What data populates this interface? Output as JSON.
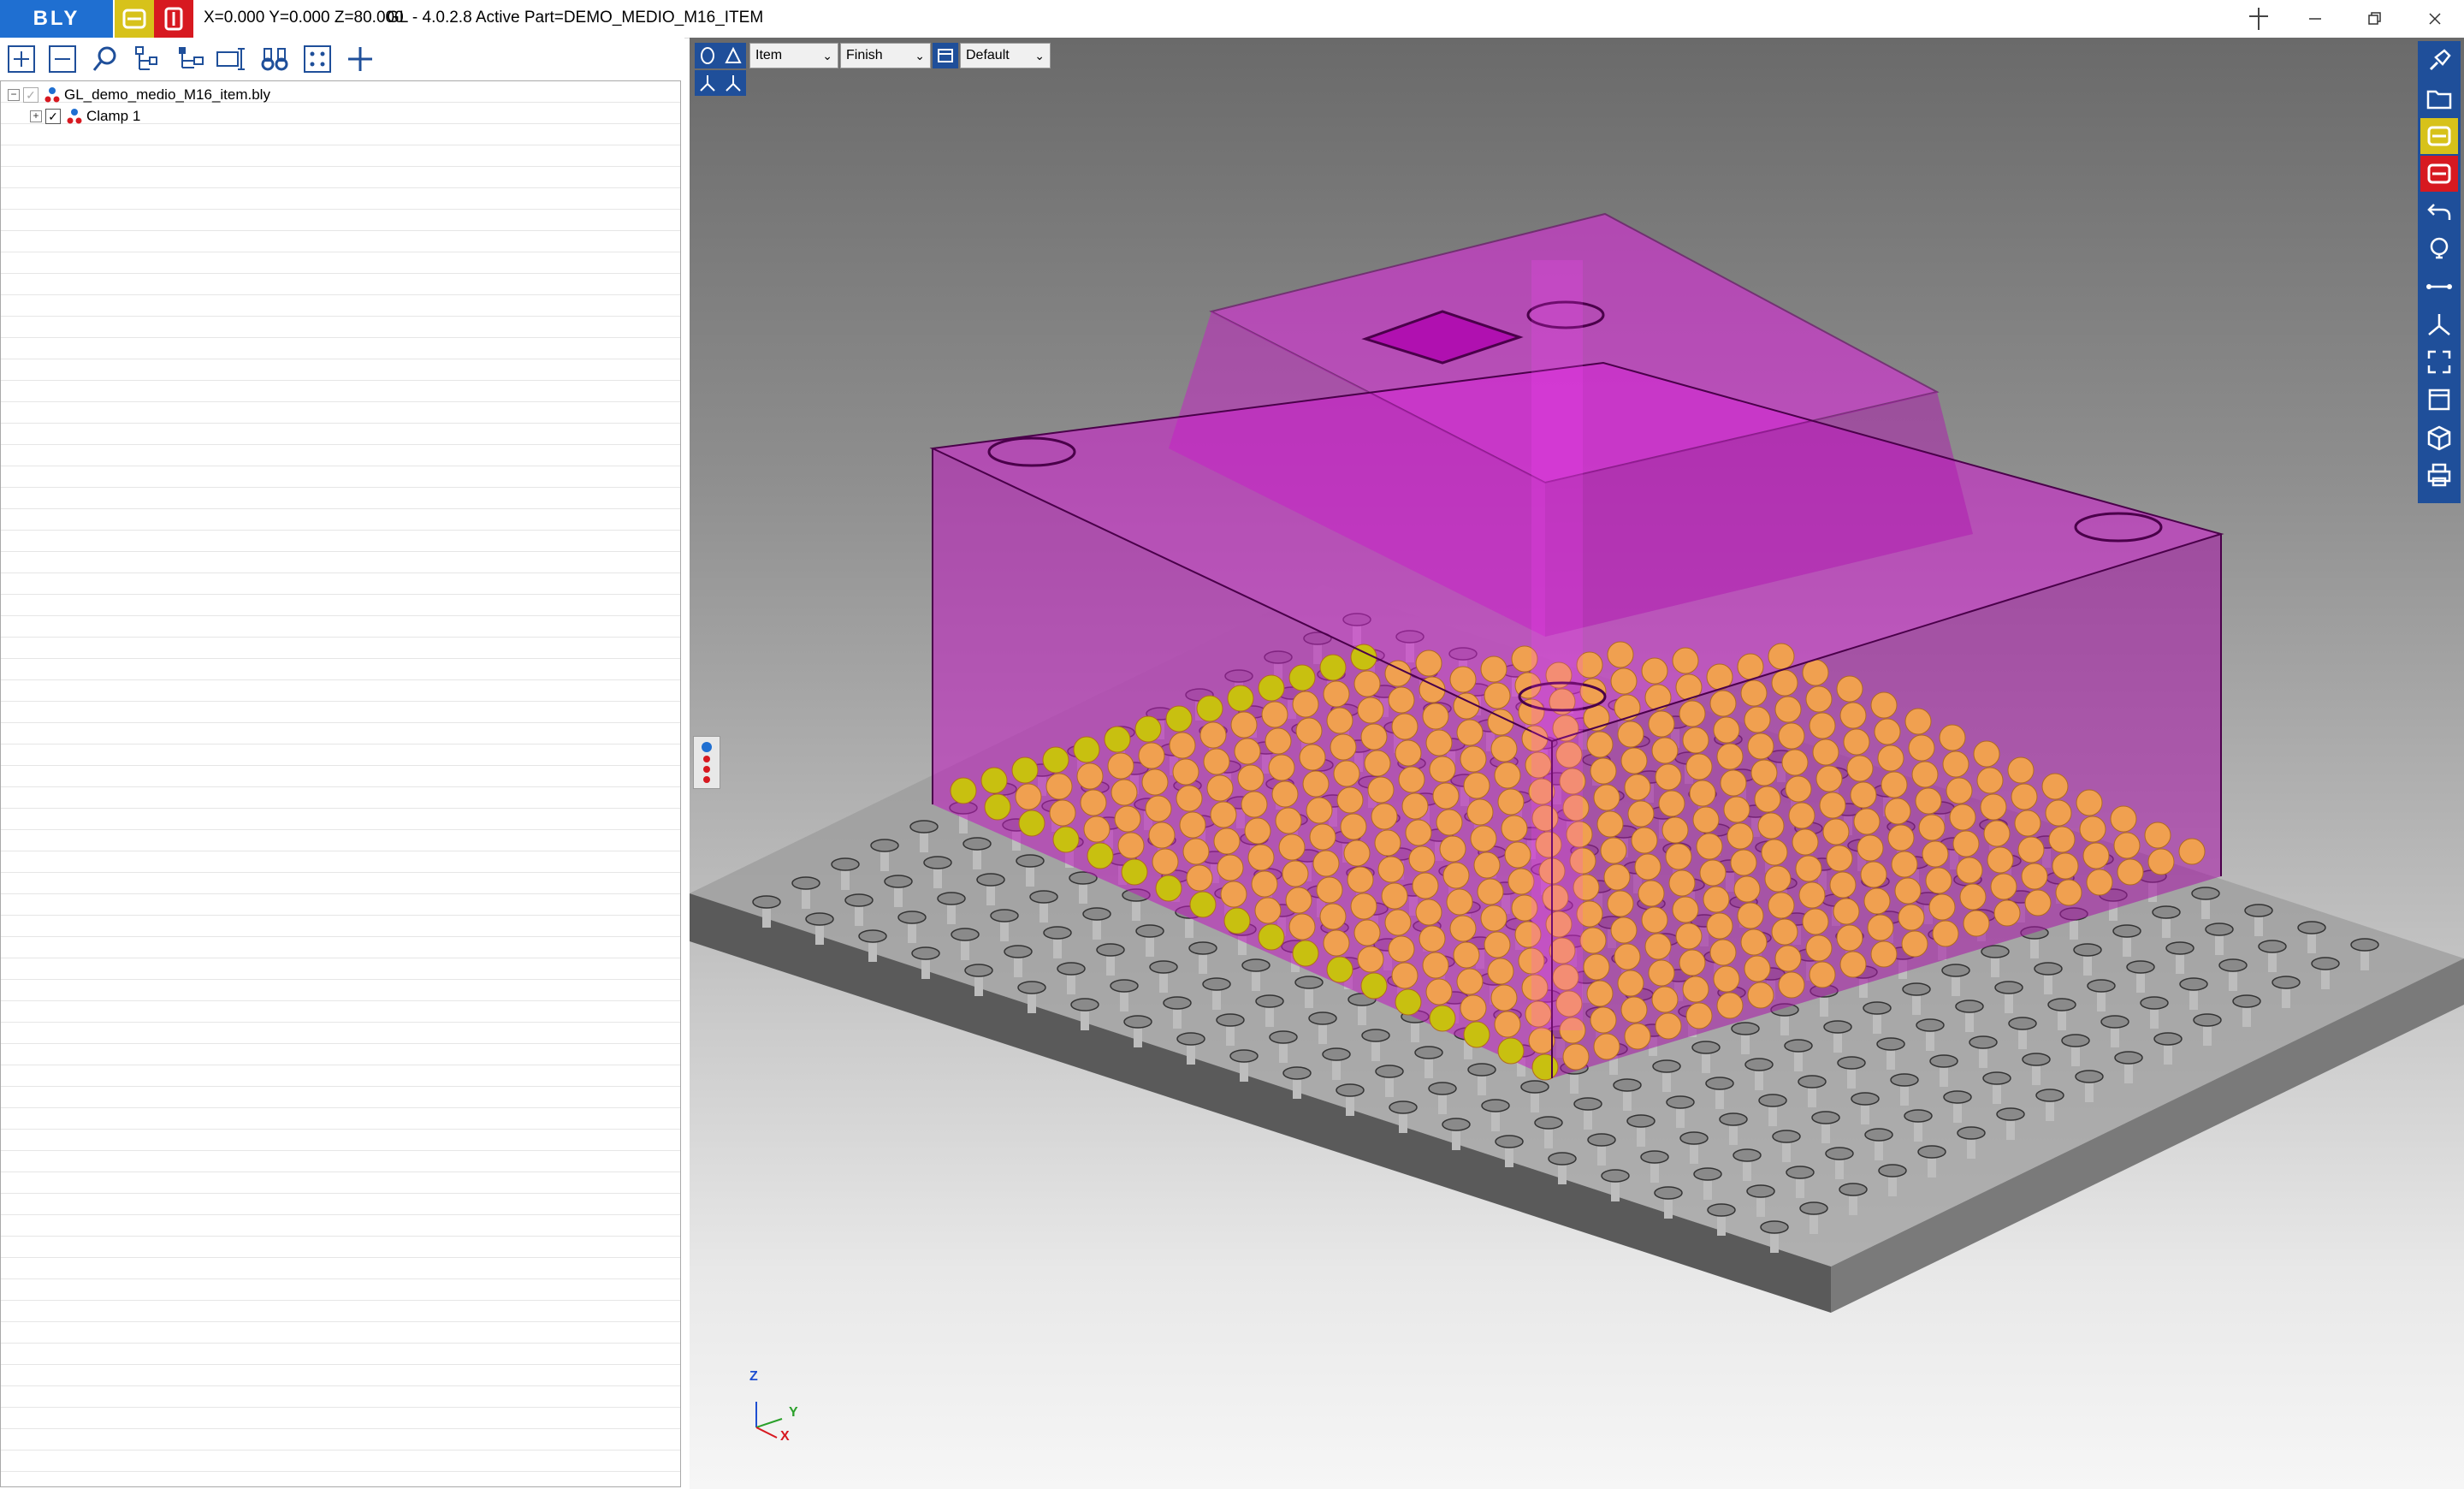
{
  "titlebar": {
    "logo": "BLY",
    "coords": "X=0.000 Y=0.000 Z=80.000",
    "title": "GL - 4.0.2.8 Active Part=DEMO_MEDIO_M16_ITEM"
  },
  "tree": {
    "root": "GL_demo_medio_M16_item.bly",
    "child": "Clamp 1"
  },
  "viewport_toolbar": {
    "select1": "Item",
    "select2": "Finish",
    "select3": "Default"
  },
  "axes": {
    "z": "Z",
    "y": "Y",
    "x": "X"
  },
  "colors": {
    "accent": "#1f4f9a",
    "logo": "#1f6fd1",
    "part": "#d01ad0",
    "balls": "#f0a050"
  }
}
